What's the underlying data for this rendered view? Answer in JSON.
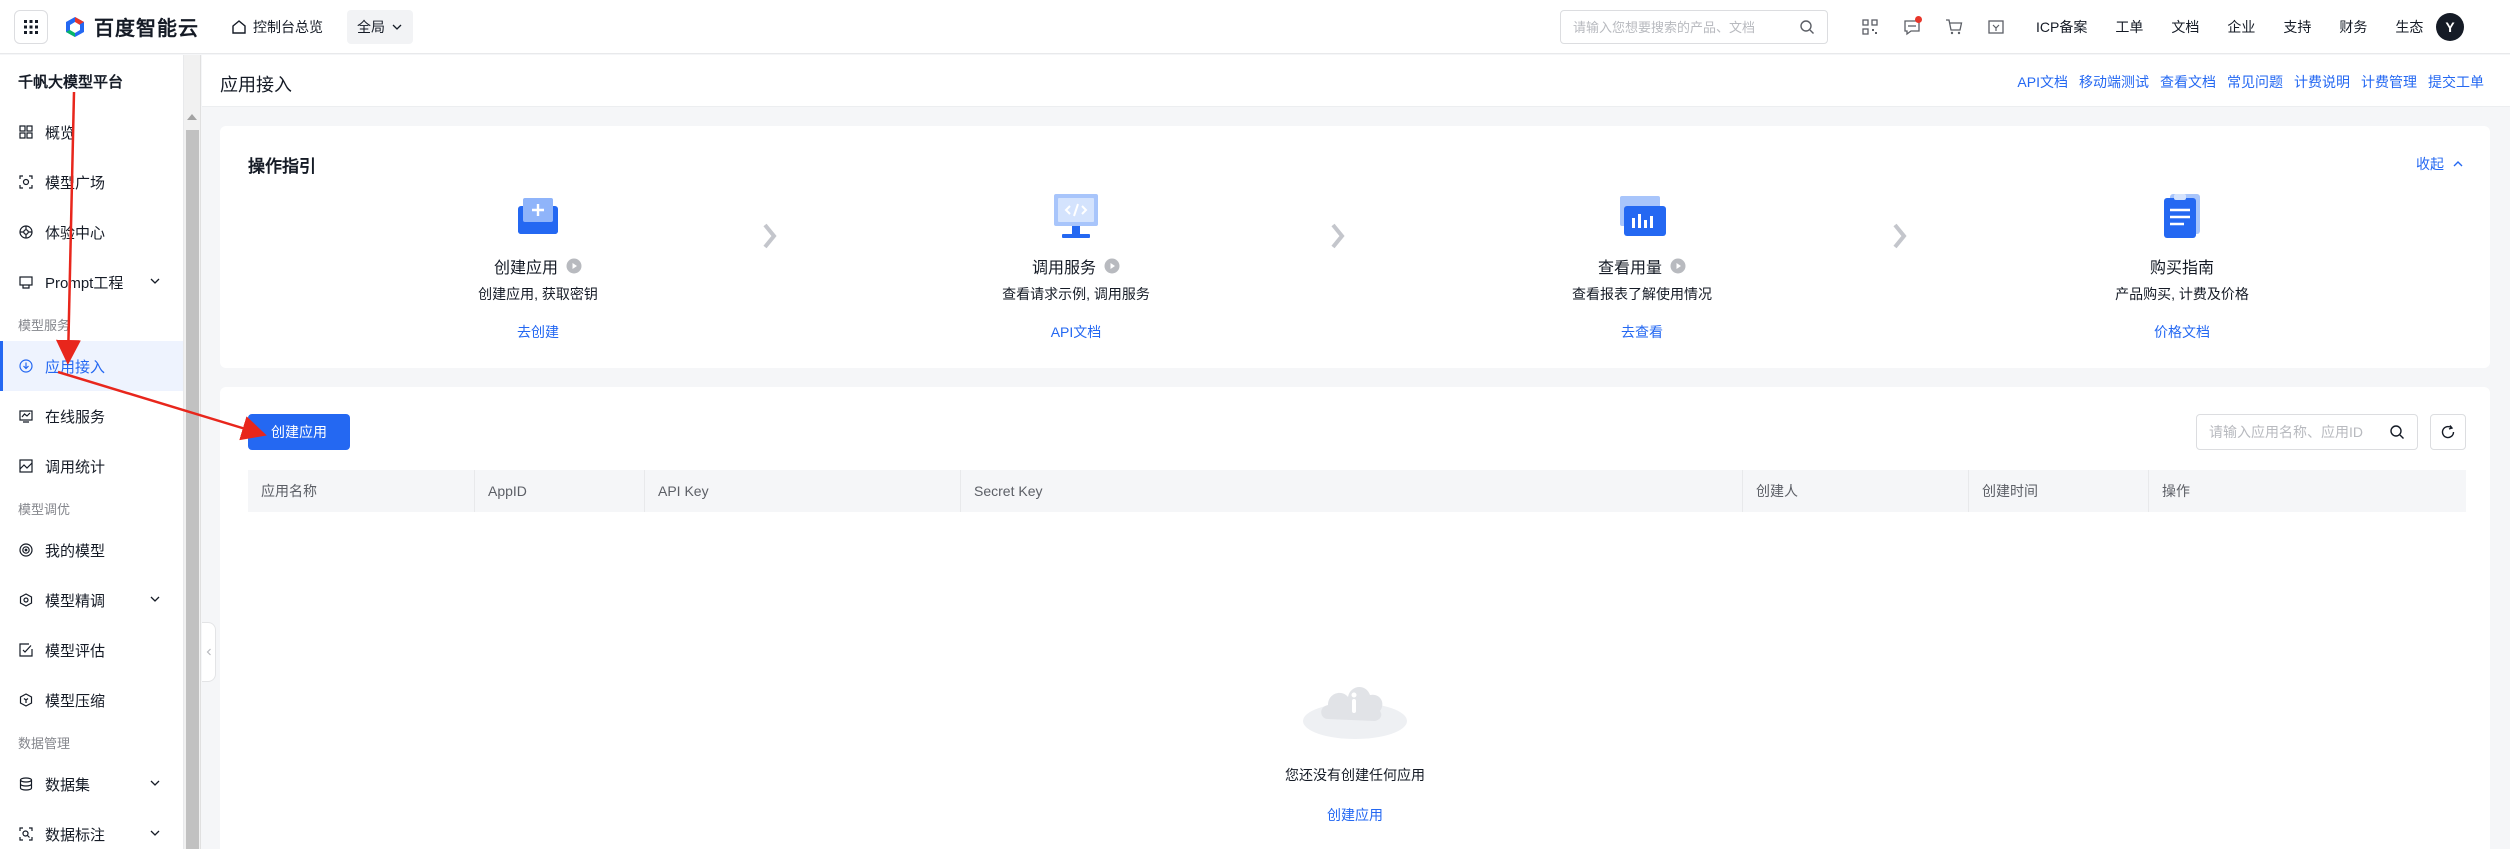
{
  "topbar": {
    "brand": "百度智能云",
    "console_link": "控制台总览",
    "region": "全局",
    "search_placeholder": "请输入您想要搜索的产品、文档",
    "nav": [
      "ICP备案",
      "工单",
      "文档",
      "企业",
      "支持",
      "财务",
      "生态"
    ],
    "avatar_letter": "Y",
    "icons": [
      "qr-code-icon",
      "message-icon",
      "cart-icon",
      "billing-icon"
    ]
  },
  "sidebar": {
    "title": "千帆大模型平台",
    "items": [
      {
        "label": "概览",
        "icon": "overview-icon"
      },
      {
        "label": "模型广场",
        "icon": "model-square-icon"
      },
      {
        "label": "体验中心",
        "icon": "experience-icon"
      },
      {
        "label": "Prompt工程",
        "icon": "prompt-icon",
        "expandable": true
      }
    ],
    "group_service": "模型服务",
    "service_items": [
      {
        "label": "应用接入",
        "icon": "app-access-icon",
        "active": true
      },
      {
        "label": "在线服务",
        "icon": "online-service-icon"
      },
      {
        "label": "调用统计",
        "icon": "stats-icon"
      }
    ],
    "group_tuning": "模型调优",
    "tuning_items": [
      {
        "label": "我的模型",
        "icon": "my-model-icon"
      },
      {
        "label": "模型精调",
        "icon": "finetune-icon",
        "expandable": true
      },
      {
        "label": "模型评估",
        "icon": "evaluate-icon"
      },
      {
        "label": "模型压缩",
        "icon": "compress-icon"
      }
    ],
    "group_data": "数据管理",
    "data_items": [
      {
        "label": "数据集",
        "icon": "dataset-icon",
        "expandable": true
      },
      {
        "label": "数据标注",
        "icon": "annotation-icon",
        "expandable": true
      }
    ]
  },
  "page": {
    "title": "应用接入",
    "header_links": [
      "API文档",
      "移动端测试",
      "查看文档",
      "常见问题",
      "计费说明",
      "计费管理",
      "提交工单"
    ]
  },
  "guide": {
    "title": "操作指引",
    "collapse_label": "收起",
    "steps": [
      {
        "name": "创建应用",
        "desc": "创建应用, 获取密钥",
        "link": "去创建",
        "has_play": true
      },
      {
        "name": "调用服务",
        "desc": "查看请求示例, 调用服务",
        "link": "API文档",
        "has_play": true
      },
      {
        "name": "查看用量",
        "desc": "查看报表了解使用情况",
        "link": "去查看",
        "has_play": true
      },
      {
        "name": "购买指南",
        "desc": "产品购买, 计费及价格",
        "link": "价格文档",
        "has_play": false
      }
    ]
  },
  "list": {
    "create_button": "创建应用",
    "search_placeholder": "请输入应用名称、应用ID",
    "columns": [
      "应用名称",
      "AppID",
      "API Key",
      "Secret Key",
      "创建人",
      "创建时间",
      "操作"
    ],
    "empty_text": "您还没有创建任何应用",
    "empty_link": "创建应用"
  },
  "colors": {
    "accent": "#2468f2",
    "annotation_arrow": "#e8261c",
    "active_bg": "#eef3fe"
  }
}
